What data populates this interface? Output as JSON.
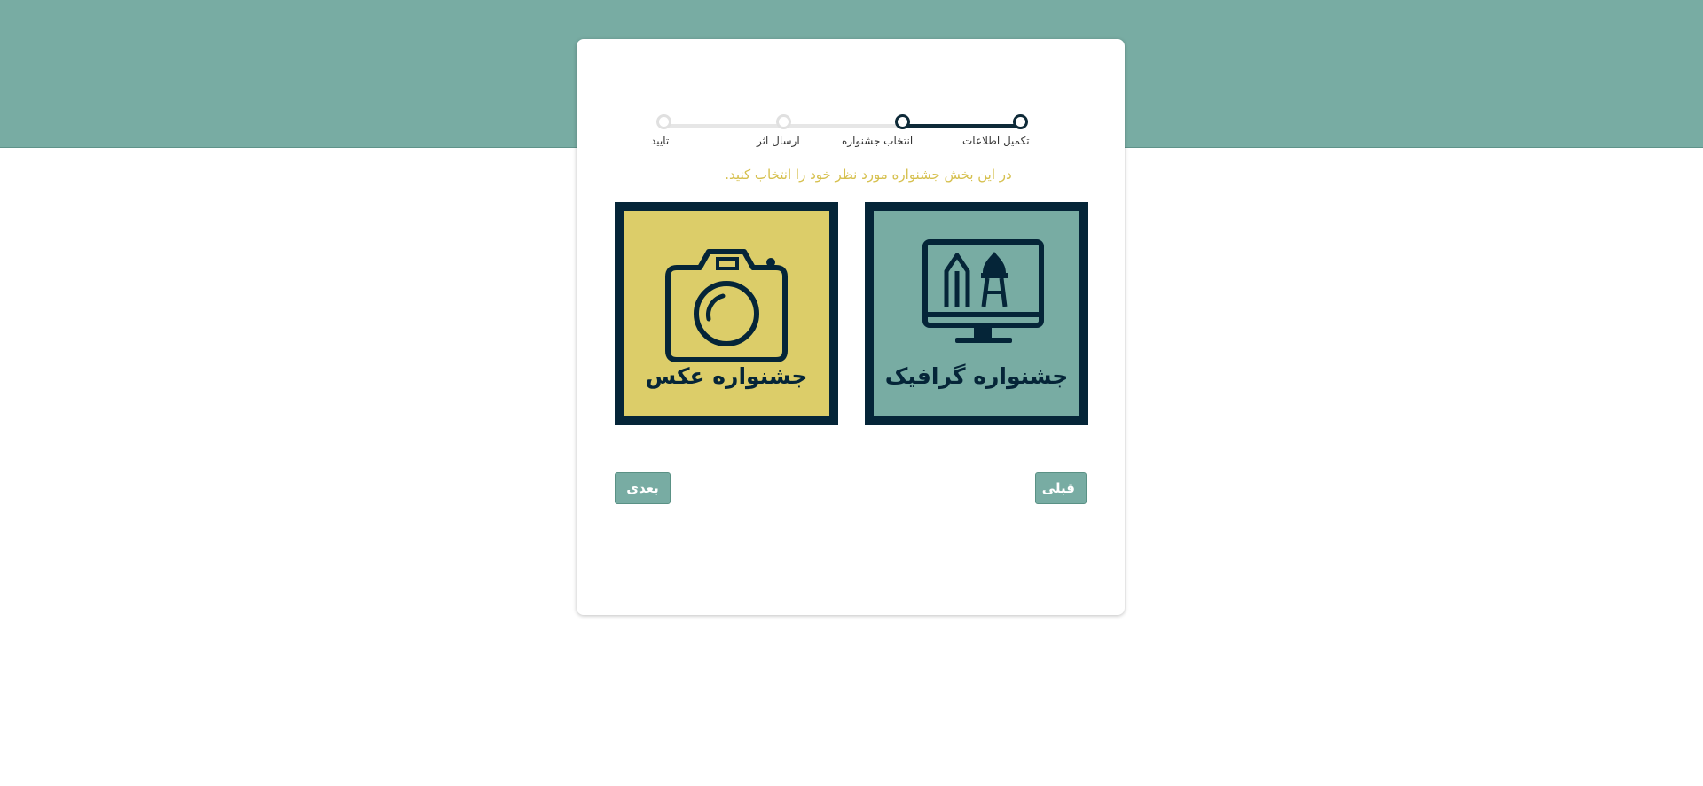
{
  "stepper": {
    "steps": [
      {
        "label": "تکمیل اطلاعات",
        "state": "done"
      },
      {
        "label": "انتخاب جشنواره",
        "state": "done"
      },
      {
        "label": "ارسال اثر",
        "state": "todo"
      },
      {
        "label": "تایید",
        "state": "todo"
      }
    ]
  },
  "instruction": "در این بخش جشنواره مورد نظر خود را انتخاب کنید.",
  "festivals": {
    "graphic": {
      "label": "جشنواره گرافیک",
      "icon": "monitor-design-icon"
    },
    "photo": {
      "label": "جشنواره عکس",
      "icon": "camera-icon"
    }
  },
  "buttons": {
    "prev": "قبلی",
    "next": "بعدی"
  },
  "colors": {
    "header": "#78aca3",
    "dark": "#052538",
    "photo_bg": "#dccd69",
    "instruction_text": "#d6c04e"
  }
}
